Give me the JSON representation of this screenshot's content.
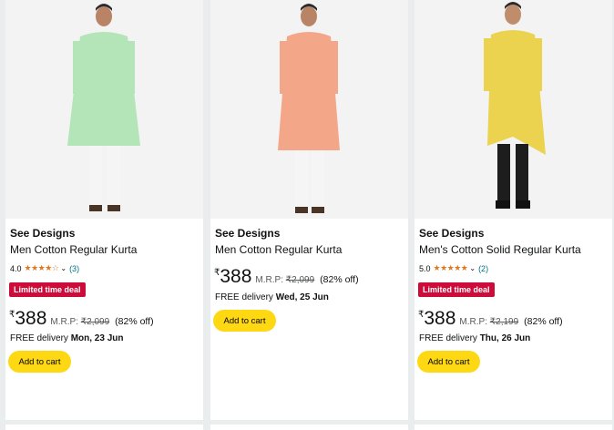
{
  "products": [
    {
      "brand": "See Designs",
      "title": "Men Cotton Regular Kurta",
      "rating": "4.0",
      "stars": "★★★★☆",
      "review_count": "(3)",
      "deal_label": "Limited time deal",
      "currency": "₹",
      "price": "388",
      "mrp_label": "M.R.P:",
      "mrp": "₹2,099",
      "discount": "(82% off)",
      "delivery_prefix": "FREE delivery ",
      "delivery_date": "Mon, 23 Jun",
      "cart_label": "Add to cart",
      "kurta_color": "#b3e5b8",
      "pants_color": "#f5f5f5"
    },
    {
      "brand": "See Designs",
      "title": "Men Cotton Regular Kurta",
      "currency": "₹",
      "price": "388",
      "mrp_label": "M.R.P:",
      "mrp": "₹2,099",
      "discount": "(82% off)",
      "delivery_prefix": "FREE delivery ",
      "delivery_date": "Wed, 25 Jun",
      "cart_label": "Add to cart",
      "kurta_color": "#f4a689",
      "pants_color": "#f5f5f5"
    },
    {
      "brand": "See Designs",
      "title": "Men's Cotton Solid Regular Kurta",
      "rating": "5.0",
      "stars": "★★★★★",
      "review_count": "(2)",
      "deal_label": "Limited time deal",
      "currency": "₹",
      "price": "388",
      "mrp_label": "M.R.P:",
      "mrp": "₹2,199",
      "discount": "(82% off)",
      "delivery_prefix": "FREE delivery ",
      "delivery_date": "Thu, 26 Jun",
      "cart_label": "Add to cart",
      "kurta_color": "#ecd34f",
      "pants_color": "#1d1d1d"
    }
  ],
  "colors": {
    "deal_badge": "#cc0c39",
    "cart_button": "#ffd814",
    "star": "#de7921",
    "link": "#007185"
  }
}
